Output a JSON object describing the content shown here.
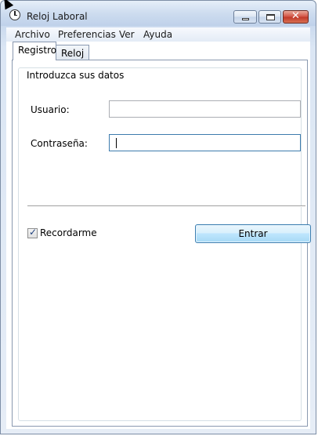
{
  "window": {
    "title": "Reloj Laboral",
    "app_icon": "clock-icon",
    "controls": [
      "minimize-icon",
      "maximize-icon",
      "close-icon"
    ]
  },
  "menu": {
    "items": [
      {
        "label": "Archivo"
      },
      {
        "label": "Preferencias"
      },
      {
        "label": "Ver"
      },
      {
        "label": "Ayuda"
      }
    ]
  },
  "tabs": [
    {
      "label": "Registro",
      "active": true
    },
    {
      "label": "Reloj",
      "active": false
    }
  ],
  "login": {
    "group_title": "Introduzca sus datos",
    "user_label": "Usuario:",
    "user_value": "",
    "password_label": "Contraseña:",
    "password_value": "",
    "remember_label": "Recordarme",
    "remember_checked": true,
    "submit_label": "Entrar"
  },
  "colors": {
    "close_button": "#c23b2a",
    "accent": "#3c7fb1"
  }
}
